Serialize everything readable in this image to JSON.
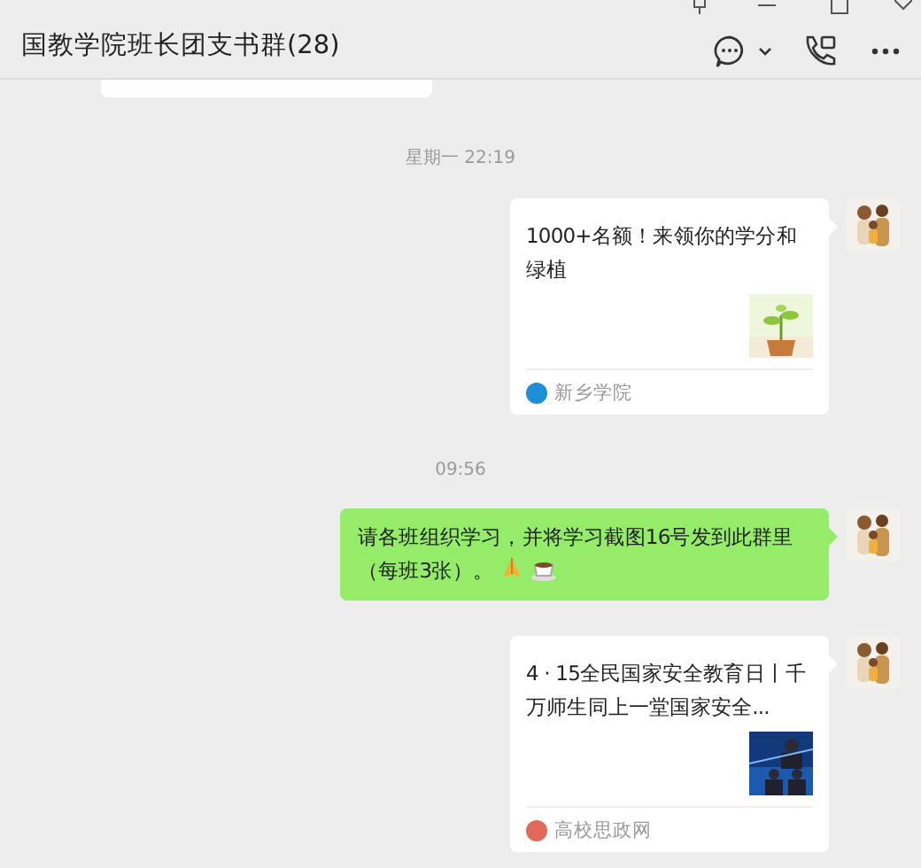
{
  "window": {
    "title": "国教学院班长团支书群(28)"
  },
  "messages": [
    {
      "kind": "time",
      "text": "星期一 22:19"
    },
    {
      "kind": "card",
      "title": "1000+名额！来领你的学分和绿植",
      "source": "新乡学院",
      "color": "#1d8fd6"
    },
    {
      "kind": "time",
      "text": "09:56"
    },
    {
      "kind": "text",
      "text": "请各班组织学习，并将学习截图16号发到此群里（每班3张）。"
    },
    {
      "kind": "card",
      "title": "4 · 15全民国家安全教育日丨千万师生同上一堂国家安全...",
      "source": "高校思政网",
      "color": "#e06a5a"
    }
  ]
}
